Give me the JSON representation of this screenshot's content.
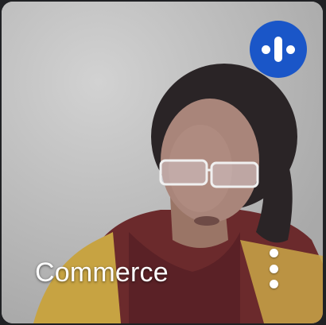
{
  "tile": {
    "participant_name": "Commerce",
    "speaking_indicator_icon": "audio-activity-icon",
    "more_options_icon": "more-vert-icon"
  },
  "colors": {
    "indicator_bg": "#1a56c8",
    "name_text": "#ffffff",
    "page_bg": "#202124"
  }
}
